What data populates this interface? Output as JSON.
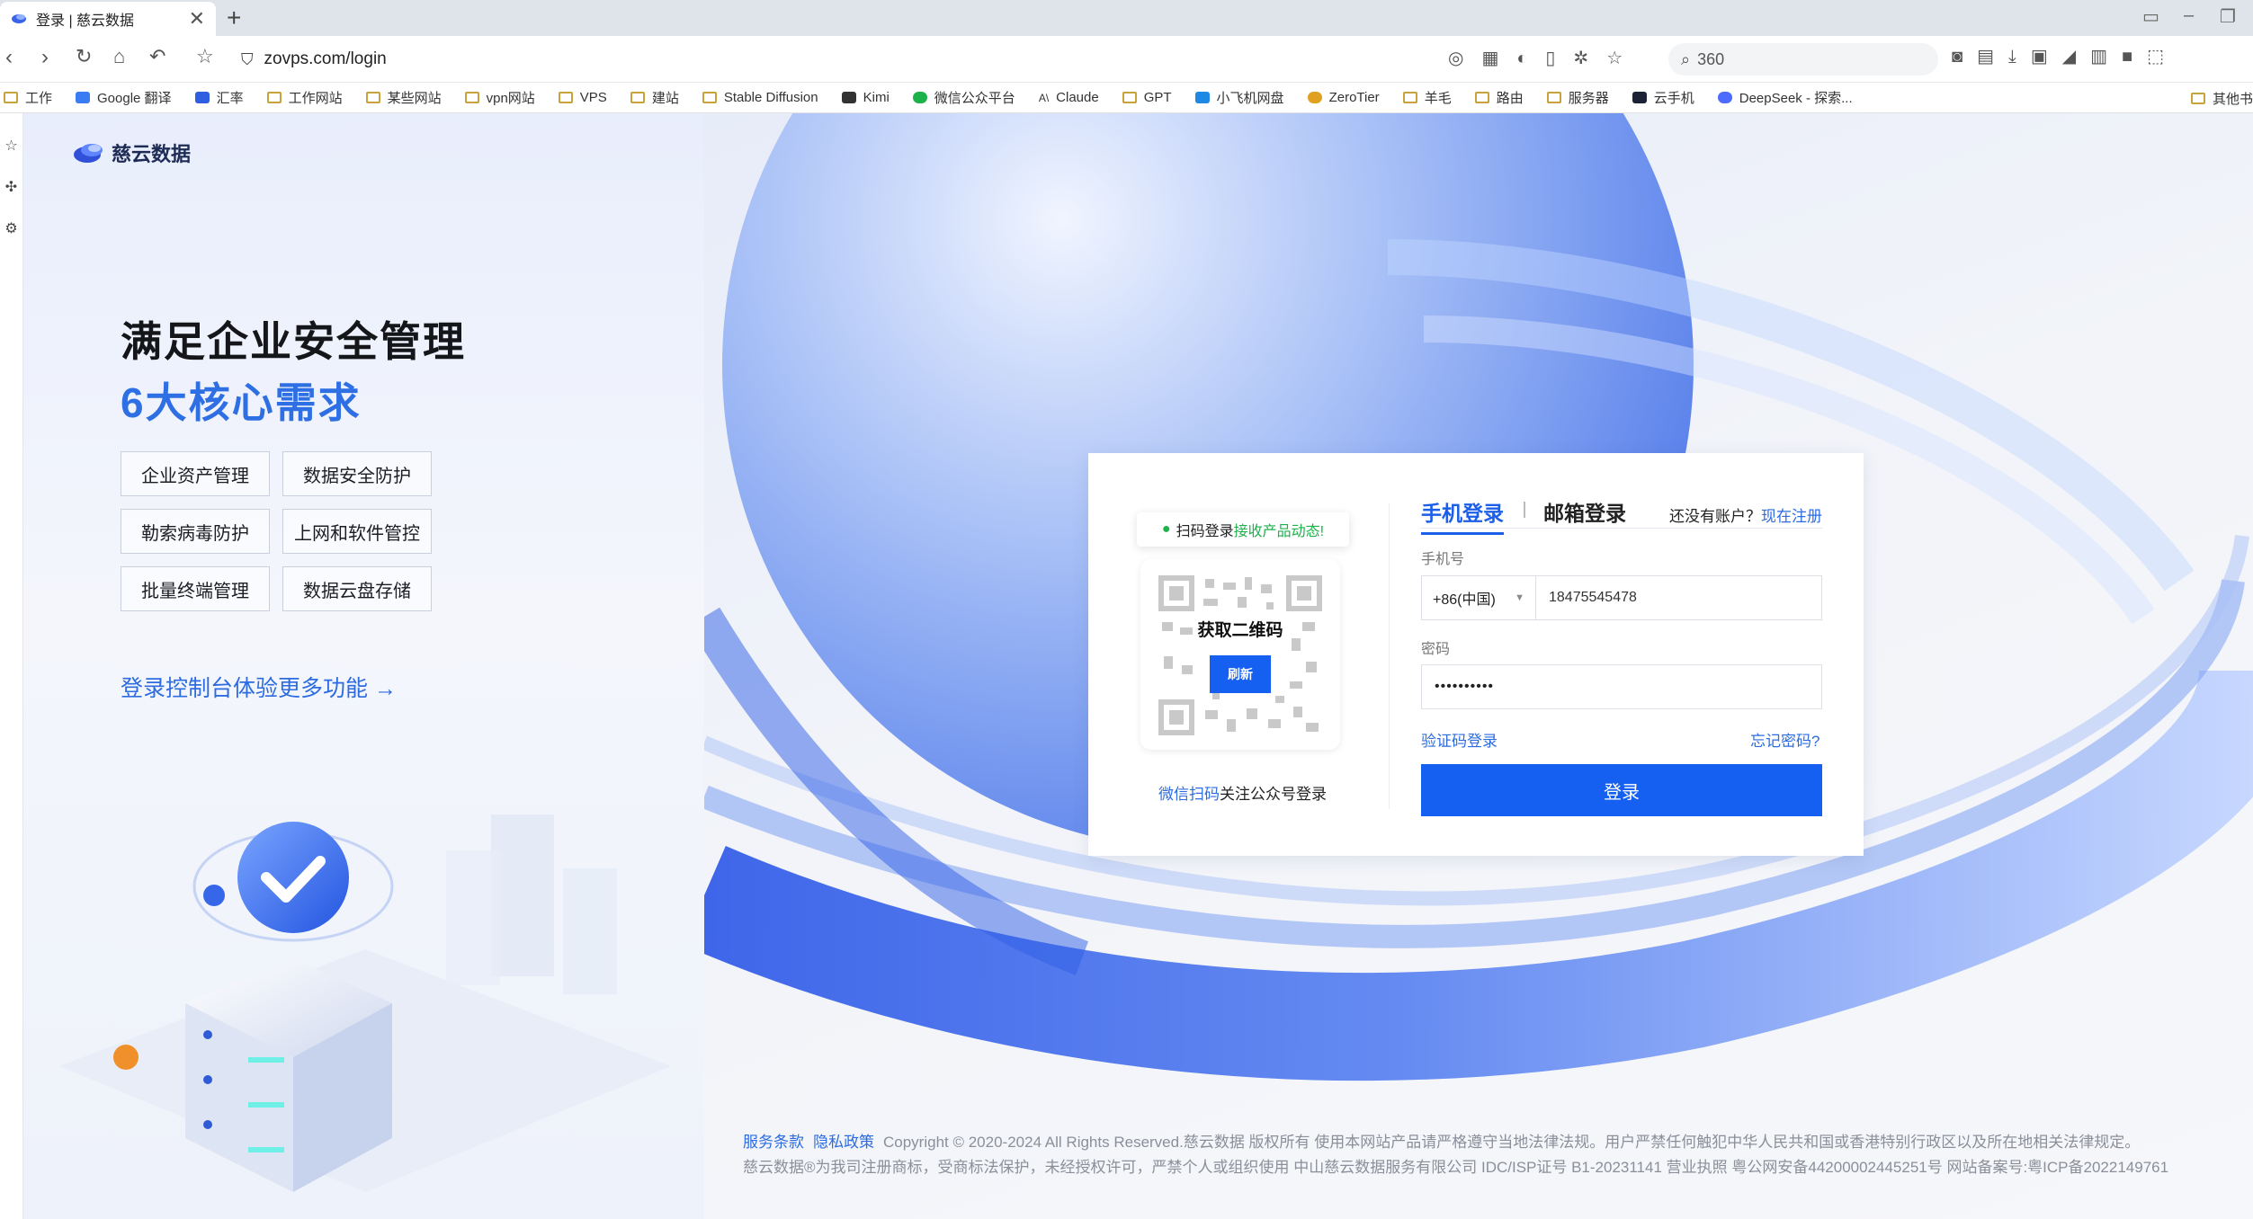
{
  "browser": {
    "tab_title": "登录 | 慈云数据",
    "tab_close": "✕",
    "new_tab": "+",
    "url": "zovps.com/login",
    "search_text": "360",
    "bookmarks": [
      "工作",
      "Google 翻译",
      "汇率",
      "工作网站",
      "某些网站",
      "vpn网站",
      "VPS",
      "建站",
      "Stable Diffusion",
      "Kimi",
      "微信公众平台",
      "Claude",
      "GPT",
      "小飞机网盘",
      "ZeroTier",
      "羊毛",
      "路由",
      "服务器",
      "云手机",
      "DeepSeek - 探索..."
    ],
    "bookmarks_other": "其他书"
  },
  "brand": {
    "name": "慈云数据"
  },
  "hero": {
    "line1": "满足企业安全管理",
    "line2": "6大核心需求",
    "features": [
      "企业资产管理",
      "数据安全防护",
      "勒索病毒防护",
      "上网和软件管控",
      "批量终端管理",
      "数据云盘存储"
    ],
    "cta": "登录控制台体验更多功能 →"
  },
  "qr": {
    "tip_prefix": "扫码登录",
    "tip_highlight": "接收产品动态!",
    "overlay_title": "获取二维码",
    "refresh": "刷新",
    "footer_link": "微信扫码",
    "footer_text": "关注公众号登录"
  },
  "login": {
    "tab_phone": "手机登录",
    "tab_email": "邮箱登录",
    "no_account": "还没有账户？",
    "register": "现在注册",
    "phone_label": "手机号",
    "country_code": "+86(中国)",
    "phone_value": "18475545478",
    "password_label": "密码",
    "password_value": "••••••••••",
    "sms_login": "验证码登录",
    "forgot": "忘记密码?",
    "submit": "登录"
  },
  "footer": {
    "terms": "服务条款",
    "privacy": "隐私政策",
    "line1": "Copyright © 2020-2024 All Rights Reserved.慈云数据 版权所有  使用本网站产品请严格遵守当地法律法规。用户严禁任何触犯中华人民共和国或香港特别行政区以及所在地相关法律规定。",
    "line2": "慈云数据®为我司注册商标，受商标法保护，未经授权许可，严禁个人或组织使用  中山慈云数据服务有限公司  IDC/ISP证号 B1-20231141  营业执照  粤公网安备44200002445251号  网站备案号:粤ICP备2022149761"
  },
  "colors": {
    "accent": "#1560f0",
    "link": "#2d6ce0",
    "wechat": "#1bb24a"
  }
}
